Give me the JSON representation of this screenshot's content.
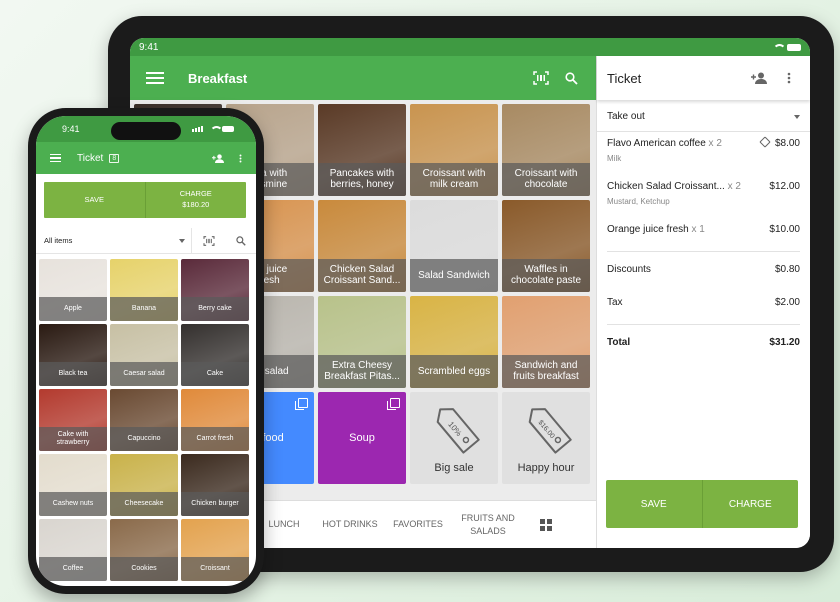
{
  "tablet": {
    "status": {
      "time": "9:41"
    },
    "appbar": {
      "title": "Breakfast",
      "menu_icon": "menu-icon",
      "barcode_icon": "barcode-scan-icon",
      "search_icon": "search-icon"
    },
    "items": [
      {
        "label": "",
        "bg": "#3a2e28"
      },
      {
        "label": "Green tea with jasmine",
        "visible_label": "tea with\njasmine",
        "bg": "#b8a48c"
      },
      {
        "label": "Pancakes with berries, honey",
        "bg": "#5a3a26"
      },
      {
        "label": "Croissant with milk cream",
        "bg": "#c9944f"
      },
      {
        "label": "Croissant with chocolate",
        "bg": "#a88a62"
      },
      {
        "label": "",
        "bg": "#2b2b2b"
      },
      {
        "label": "Orange juice fresh",
        "visible_label": "ge juice\nresh",
        "bg": "#d8934e"
      },
      {
        "label": "Chicken Salad Croissant Sand...",
        "bg": "#c98a3c"
      },
      {
        "label": "Salad Sandwich",
        "bg": "#dcdcdc"
      },
      {
        "label": "Waffles in chocolate paste",
        "bg": "#8a5a2a"
      },
      {
        "label": "",
        "bg": "#3a3a3a"
      },
      {
        "label": "Greek salad",
        "visible_label": "ek salad",
        "bg": "#b9b5ad"
      },
      {
        "label": "Extra Cheesy Breakfast Pitas...",
        "bg": "#b8c28a"
      },
      {
        "label": "Scrambled eggs",
        "bg": "#d9b445"
      },
      {
        "label": "Sandwich and fruits breakfast",
        "bg": "#e1a070"
      },
      {
        "label": "",
        "bg": "#ececec"
      },
      {
        "label": "Seafood",
        "visible_label": "afood",
        "bg": "#448aff",
        "type": "category"
      },
      {
        "label": "Soup",
        "bg": "#9c27b0",
        "type": "category"
      },
      {
        "label": "Big sale",
        "tag_text": "10%",
        "type": "discount"
      },
      {
        "label": "Happy hour",
        "tag_text": "$16.00",
        "type": "discount"
      }
    ],
    "bottom_nav": [
      "LUNCH",
      "HOT DRINKS",
      "FAVORITES",
      "FRUITS AND SALADS"
    ],
    "bottom_nav_grid_icon": "grid-view-icon",
    "ticket": {
      "title": "Ticket",
      "dining_option": "Take out",
      "lines": [
        {
          "name": "Flavo American coffee",
          "qty": "x 2",
          "price": "$8.00",
          "modifier": "Milk",
          "has_discount_tag": true
        },
        {
          "name": "Chicken Salad Croissant...",
          "qty": "x 2",
          "price": "$12.00",
          "modifier": "Mustard, Ketchup"
        },
        {
          "name": "Orange juice fresh",
          "qty": "x 1",
          "price": "$10.00",
          "modifier": ""
        }
      ],
      "discounts_label": "Discounts",
      "discounts_value": "$0.80",
      "tax_label": "Tax",
      "tax_value": "$2.00",
      "total_label": "Total",
      "total_value": "$31.20",
      "save_label": "SAVE",
      "charge_label": "CHARGE"
    }
  },
  "phone": {
    "status": {
      "time": "9:41"
    },
    "appbar": {
      "title": "Ticket",
      "badge": "8"
    },
    "save_label": "SAVE",
    "charge_label": "CHARGE",
    "charge_amount": "$180.20",
    "filter_label": "All items",
    "items": [
      {
        "label": "Apple",
        "bg": "#e7e2dc"
      },
      {
        "label": "Banana",
        "bg": "#e6d26a"
      },
      {
        "label": "Berry cake",
        "bg": "#5a2a3a"
      },
      {
        "label": "Black tea",
        "bg": "#2a1a12"
      },
      {
        "label": "Caesar salad",
        "bg": "#c7c0a4"
      },
      {
        "label": "Cake",
        "bg": "#34302e"
      },
      {
        "label": "Cake with strawberry",
        "bg": "#b33a2e"
      },
      {
        "label": "Capuccino",
        "bg": "#6a4a32"
      },
      {
        "label": "Carrot fresh",
        "bg": "#e08a3a"
      },
      {
        "label": "Cashew nuts",
        "bg": "#e3dccd"
      },
      {
        "label": "Cheesecake",
        "bg": "#c9b24a"
      },
      {
        "label": "Chicken burger",
        "bg": "#3b2a1e"
      },
      {
        "label": "Coffee",
        "bg": "#d9d5cf"
      },
      {
        "label": "Cookies",
        "bg": "#8a6a4a"
      },
      {
        "label": "Croissant",
        "bg": "#e3a24e"
      }
    ]
  },
  "colors": {
    "primary_green": "#4caf50",
    "status_green": "#3f9a42",
    "button_green": "#7cb342",
    "seafood_blue": "#448aff",
    "soup_purple": "#9c27b0"
  }
}
